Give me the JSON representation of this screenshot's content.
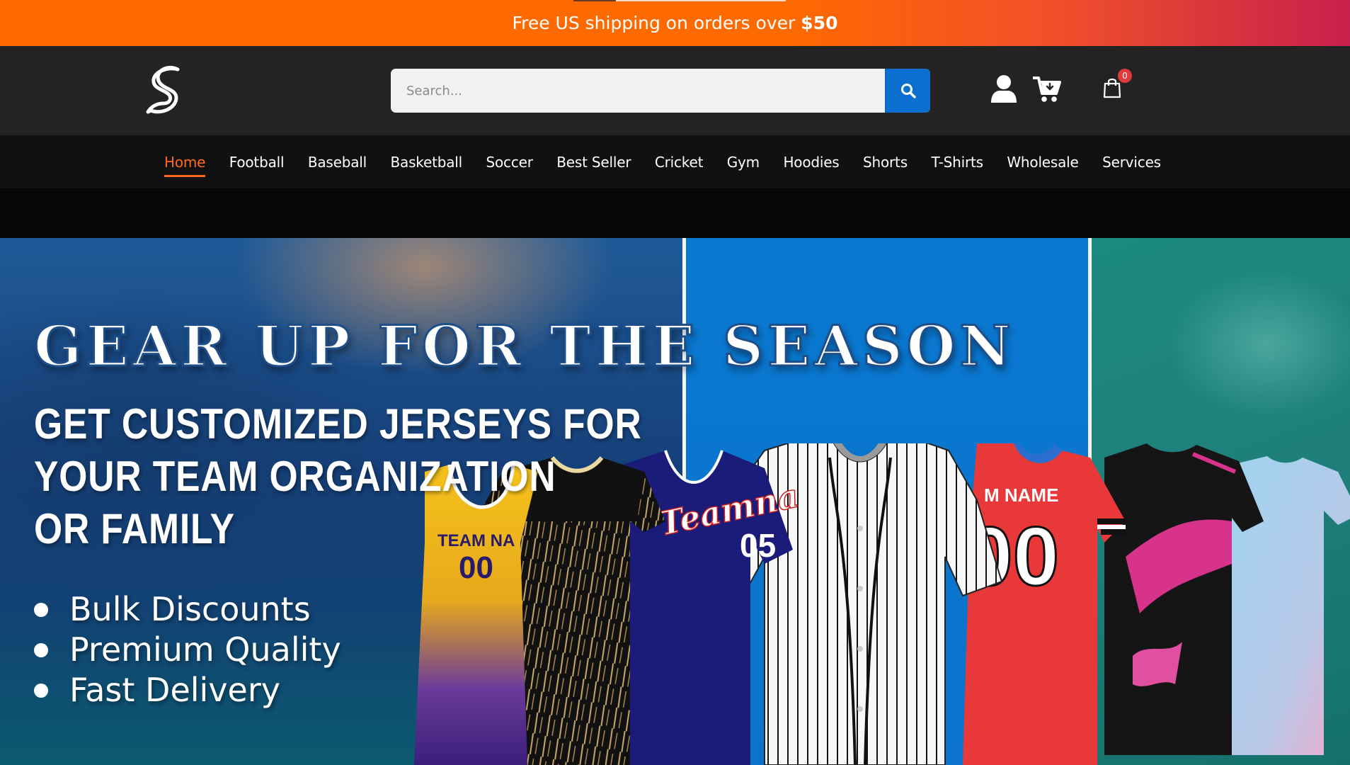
{
  "announcement": {
    "text": "Free US shipping on orders over",
    "amount": "$50"
  },
  "header": {
    "logo_icon": "s-logo-icon",
    "search": {
      "placeholder": "Search...",
      "value": ""
    },
    "icons": [
      "search-icon",
      "user-icon",
      "cart-icon",
      "shopping-bag-icon"
    ],
    "bag_count": "0"
  },
  "nav": {
    "items": [
      {
        "label": "Home",
        "active": true
      },
      {
        "label": "Football"
      },
      {
        "label": "Baseball"
      },
      {
        "label": "Basketball"
      },
      {
        "label": "Soccer"
      },
      {
        "label": "Best Seller"
      },
      {
        "label": "Cricket"
      },
      {
        "label": "Gym"
      },
      {
        "label": "Hoodies"
      },
      {
        "label": "Shorts"
      },
      {
        "label": "T-Shirts"
      },
      {
        "label": "Wholesale"
      },
      {
        "label": "Services"
      }
    ]
  },
  "hero": {
    "title": "GEAR UP FOR THE SEASON",
    "subtitle_lines": [
      "GET CUSTOMIZED JERSEYS FOR",
      "YOUR TEAM ORGANIZATION",
      "OR FAMILY"
    ],
    "bullets": [
      "Bulk Discounts",
      "Premium Quality",
      "Fast Delivery"
    ],
    "jersey_texts": {
      "basketball": "TEAM NA",
      "basketball_number": "00",
      "baseball_script": "Teamna",
      "baseball_number": "05",
      "football_name": "M NAME",
      "football_number": "00"
    }
  },
  "colors": {
    "accent_orange": "#ff6a1a",
    "search_button": "#0b6fd0",
    "header_bg": "#242222",
    "nav_bg": "#121111"
  }
}
